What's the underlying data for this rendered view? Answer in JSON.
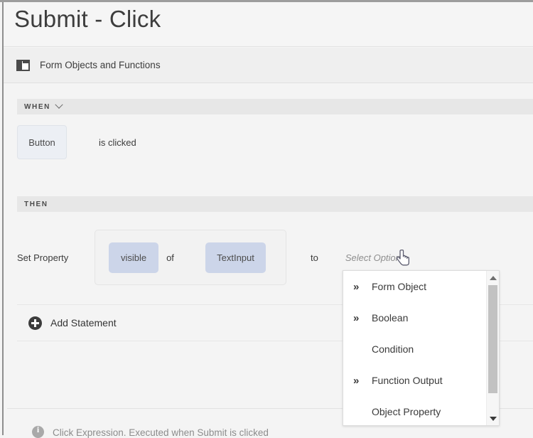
{
  "window": {
    "title": "Submit - Click"
  },
  "section_header": {
    "label": "Form Objects and Functions",
    "icon": "form-window-icon"
  },
  "when_clause": {
    "keyword": "WHEN",
    "chevron_icon": "chevron-down-icon",
    "trigger_object": "Button",
    "predicate": "is clicked"
  },
  "then_clause": {
    "keyword": "THEN",
    "statement": {
      "action_label": "Set Property",
      "property_chip": "visible",
      "connector": "of",
      "target_chip": "TextInput",
      "assign_word": "to",
      "value_placeholder": "Select Option"
    }
  },
  "add_statement": {
    "label": "Add Statement",
    "icon": "plus-circle-icon"
  },
  "dropdown": {
    "items": [
      {
        "label": "Form Object",
        "has_submenu": true,
        "arrow_icon": "double-chevron-right-icon"
      },
      {
        "label": "Boolean",
        "has_submenu": true,
        "arrow_icon": "double-chevron-right-icon"
      },
      {
        "label": "Condition",
        "has_submenu": false,
        "arrow_icon": ""
      },
      {
        "label": "Function Output",
        "has_submenu": true,
        "arrow_icon": "double-chevron-right-icon"
      },
      {
        "label": "Object Property",
        "has_submenu": false,
        "arrow_icon": ""
      }
    ],
    "submenu_glyph": "»",
    "scrollbar": {
      "up_arrow_icon": "scroll-up-arrow-icon",
      "down_arrow_icon": "scroll-down-arrow-icon"
    }
  },
  "footer": {
    "icon": "info-icon",
    "text": "Click Expression. Executed when Submit is clicked"
  },
  "cursor": {
    "icon": "pointing-hand-cursor"
  },
  "colors": {
    "page_background": "#f4f4f4",
    "band_background": "#e7e7e7",
    "chip_blue": "#ccd5e9",
    "chip_grey": "#eceff4",
    "text_primary": "#3b3b3b",
    "text_muted": "#8e8e8e"
  }
}
